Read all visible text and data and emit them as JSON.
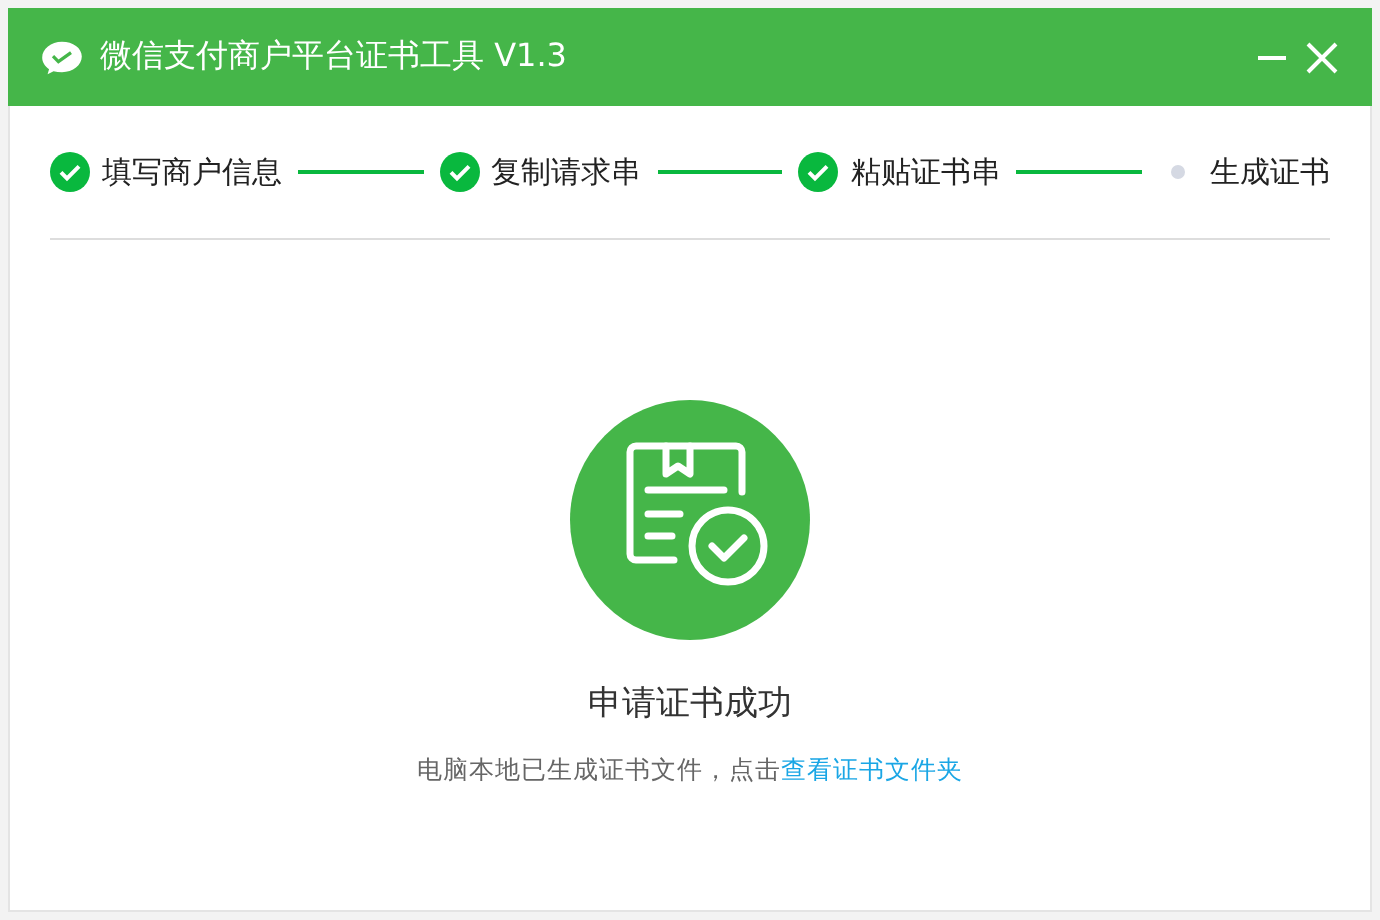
{
  "window": {
    "title": "微信支付商户平台证书工具 V1.3"
  },
  "steps": [
    {
      "label": "填写商户信息",
      "done": true
    },
    {
      "label": "复制请求串",
      "done": true
    },
    {
      "label": "粘贴证书串",
      "done": true
    },
    {
      "label": "生成证书",
      "done": false
    }
  ],
  "result": {
    "heading": "申请证书成功",
    "message": "电脑本地已生成证书文件，点击",
    "link": "查看证书文件夹"
  }
}
